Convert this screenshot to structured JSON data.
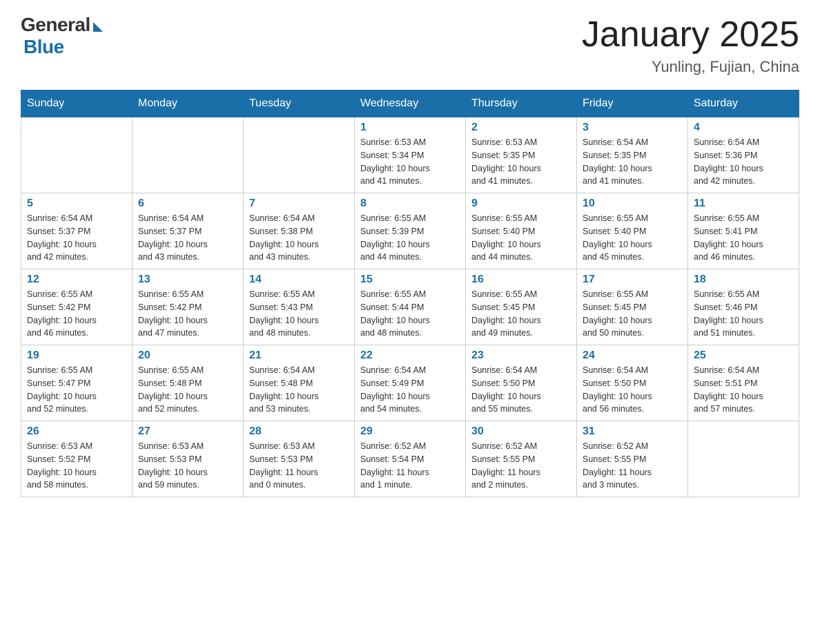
{
  "header": {
    "logo": {
      "general": "General",
      "blue": "Blue"
    },
    "title": "January 2025",
    "location": "Yunling, Fujian, China"
  },
  "days_of_week": [
    "Sunday",
    "Monday",
    "Tuesday",
    "Wednesday",
    "Thursday",
    "Friday",
    "Saturday"
  ],
  "weeks": [
    [
      {
        "day": "",
        "info": ""
      },
      {
        "day": "",
        "info": ""
      },
      {
        "day": "",
        "info": ""
      },
      {
        "day": "1",
        "info": "Sunrise: 6:53 AM\nSunset: 5:34 PM\nDaylight: 10 hours\nand 41 minutes."
      },
      {
        "day": "2",
        "info": "Sunrise: 6:53 AM\nSunset: 5:35 PM\nDaylight: 10 hours\nand 41 minutes."
      },
      {
        "day": "3",
        "info": "Sunrise: 6:54 AM\nSunset: 5:35 PM\nDaylight: 10 hours\nand 41 minutes."
      },
      {
        "day": "4",
        "info": "Sunrise: 6:54 AM\nSunset: 5:36 PM\nDaylight: 10 hours\nand 42 minutes."
      }
    ],
    [
      {
        "day": "5",
        "info": "Sunrise: 6:54 AM\nSunset: 5:37 PM\nDaylight: 10 hours\nand 42 minutes."
      },
      {
        "day": "6",
        "info": "Sunrise: 6:54 AM\nSunset: 5:37 PM\nDaylight: 10 hours\nand 43 minutes."
      },
      {
        "day": "7",
        "info": "Sunrise: 6:54 AM\nSunset: 5:38 PM\nDaylight: 10 hours\nand 43 minutes."
      },
      {
        "day": "8",
        "info": "Sunrise: 6:55 AM\nSunset: 5:39 PM\nDaylight: 10 hours\nand 44 minutes."
      },
      {
        "day": "9",
        "info": "Sunrise: 6:55 AM\nSunset: 5:40 PM\nDaylight: 10 hours\nand 44 minutes."
      },
      {
        "day": "10",
        "info": "Sunrise: 6:55 AM\nSunset: 5:40 PM\nDaylight: 10 hours\nand 45 minutes."
      },
      {
        "day": "11",
        "info": "Sunrise: 6:55 AM\nSunset: 5:41 PM\nDaylight: 10 hours\nand 46 minutes."
      }
    ],
    [
      {
        "day": "12",
        "info": "Sunrise: 6:55 AM\nSunset: 5:42 PM\nDaylight: 10 hours\nand 46 minutes."
      },
      {
        "day": "13",
        "info": "Sunrise: 6:55 AM\nSunset: 5:42 PM\nDaylight: 10 hours\nand 47 minutes."
      },
      {
        "day": "14",
        "info": "Sunrise: 6:55 AM\nSunset: 5:43 PM\nDaylight: 10 hours\nand 48 minutes."
      },
      {
        "day": "15",
        "info": "Sunrise: 6:55 AM\nSunset: 5:44 PM\nDaylight: 10 hours\nand 48 minutes."
      },
      {
        "day": "16",
        "info": "Sunrise: 6:55 AM\nSunset: 5:45 PM\nDaylight: 10 hours\nand 49 minutes."
      },
      {
        "day": "17",
        "info": "Sunrise: 6:55 AM\nSunset: 5:45 PM\nDaylight: 10 hours\nand 50 minutes."
      },
      {
        "day": "18",
        "info": "Sunrise: 6:55 AM\nSunset: 5:46 PM\nDaylight: 10 hours\nand 51 minutes."
      }
    ],
    [
      {
        "day": "19",
        "info": "Sunrise: 6:55 AM\nSunset: 5:47 PM\nDaylight: 10 hours\nand 52 minutes."
      },
      {
        "day": "20",
        "info": "Sunrise: 6:55 AM\nSunset: 5:48 PM\nDaylight: 10 hours\nand 52 minutes."
      },
      {
        "day": "21",
        "info": "Sunrise: 6:54 AM\nSunset: 5:48 PM\nDaylight: 10 hours\nand 53 minutes."
      },
      {
        "day": "22",
        "info": "Sunrise: 6:54 AM\nSunset: 5:49 PM\nDaylight: 10 hours\nand 54 minutes."
      },
      {
        "day": "23",
        "info": "Sunrise: 6:54 AM\nSunset: 5:50 PM\nDaylight: 10 hours\nand 55 minutes."
      },
      {
        "day": "24",
        "info": "Sunrise: 6:54 AM\nSunset: 5:50 PM\nDaylight: 10 hours\nand 56 minutes."
      },
      {
        "day": "25",
        "info": "Sunrise: 6:54 AM\nSunset: 5:51 PM\nDaylight: 10 hours\nand 57 minutes."
      }
    ],
    [
      {
        "day": "26",
        "info": "Sunrise: 6:53 AM\nSunset: 5:52 PM\nDaylight: 10 hours\nand 58 minutes."
      },
      {
        "day": "27",
        "info": "Sunrise: 6:53 AM\nSunset: 5:53 PM\nDaylight: 10 hours\nand 59 minutes."
      },
      {
        "day": "28",
        "info": "Sunrise: 6:53 AM\nSunset: 5:53 PM\nDaylight: 11 hours\nand 0 minutes."
      },
      {
        "day": "29",
        "info": "Sunrise: 6:52 AM\nSunset: 5:54 PM\nDaylight: 11 hours\nand 1 minute."
      },
      {
        "day": "30",
        "info": "Sunrise: 6:52 AM\nSunset: 5:55 PM\nDaylight: 11 hours\nand 2 minutes."
      },
      {
        "day": "31",
        "info": "Sunrise: 6:52 AM\nSunset: 5:55 PM\nDaylight: 11 hours\nand 3 minutes."
      },
      {
        "day": "",
        "info": ""
      }
    ]
  ]
}
